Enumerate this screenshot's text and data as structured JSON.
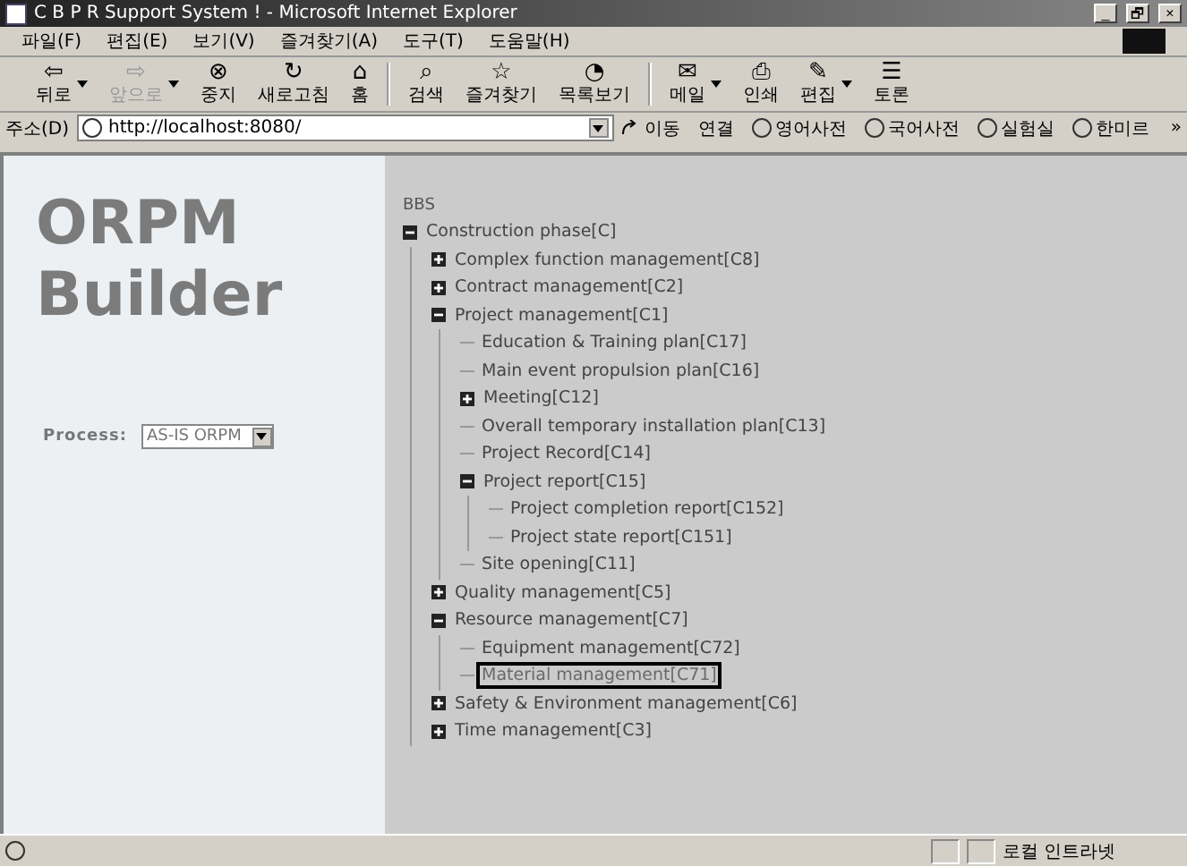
{
  "window": {
    "title": "C B P R Support System ! - Microsoft Internet Explorer",
    "controls": [
      "_",
      "🗗",
      "×"
    ]
  },
  "menu": [
    "파일(F)",
    "편집(E)",
    "보기(V)",
    "즐겨찾기(A)",
    "도구(T)",
    "도움말(H)"
  ],
  "toolbar": [
    {
      "buttons": [
        {
          "label": "뒤로",
          "glyph": "⇦",
          "dropdown": true,
          "disabled": false
        },
        {
          "label": "앞으로",
          "glyph": "⇨",
          "dropdown": true,
          "disabled": true
        },
        {
          "label": "중지",
          "glyph": "⊗",
          "dropdown": false,
          "disabled": false
        },
        {
          "label": "새로고침",
          "glyph": "↻",
          "dropdown": false,
          "disabled": false
        },
        {
          "label": "홈",
          "glyph": "⌂",
          "dropdown": false,
          "disabled": false
        }
      ]
    },
    {
      "buttons": [
        {
          "label": "검색",
          "glyph": "⌕",
          "dropdown": false,
          "disabled": false
        },
        {
          "label": "즐겨찾기",
          "glyph": "☆",
          "dropdown": false,
          "disabled": false
        },
        {
          "label": "목록보기",
          "glyph": "◔",
          "dropdown": false,
          "disabled": false
        }
      ]
    },
    {
      "buttons": [
        {
          "label": "메일",
          "glyph": "✉",
          "dropdown": true,
          "disabled": false
        },
        {
          "label": "인쇄",
          "glyph": "⎙",
          "dropdown": false,
          "disabled": false
        },
        {
          "label": "편집",
          "glyph": "✎",
          "dropdown": true,
          "disabled": false
        },
        {
          "label": "토론",
          "glyph": "☰",
          "dropdown": false,
          "disabled": false
        }
      ]
    }
  ],
  "address": {
    "label": "주소(D)",
    "value": "http://localhost:8080/",
    "go": "이동",
    "links_label": "연결",
    "links": [
      "영어사전",
      "국어사전",
      "실험실",
      "한미르"
    ],
    "more": "»"
  },
  "sidebar": {
    "title_lines": [
      "ORPM",
      "Builder"
    ],
    "process_label": "Process:",
    "process_value": "AS-IS ORPM"
  },
  "tree": {
    "root": "BBS",
    "items": [
      {
        "label": "Construction phase[C]",
        "kind": "folder",
        "expanded": true,
        "selected": false,
        "children": [
          {
            "label": "Complex function management[C8]",
            "kind": "folder",
            "expanded": false,
            "selected": false
          },
          {
            "label": "Contract management[C2]",
            "kind": "folder",
            "expanded": false,
            "selected": false
          },
          {
            "label": "Project management[C1]",
            "kind": "folder",
            "expanded": true,
            "selected": false,
            "children": [
              {
                "label": "Education & Training plan[C17]",
                "kind": "leaf",
                "selected": false
              },
              {
                "label": "Main event propulsion plan[C16]",
                "kind": "leaf",
                "selected": false
              },
              {
                "label": "Meeting[C12]",
                "kind": "folder",
                "expanded": false,
                "selected": false
              },
              {
                "label": "Overall temporary installation plan[C13]",
                "kind": "leaf",
                "selected": false
              },
              {
                "label": "Project Record[C14]",
                "kind": "leaf",
                "selected": false
              },
              {
                "label": "Project report[C15]",
                "kind": "folder",
                "expanded": true,
                "selected": false,
                "children": [
                  {
                    "label": "Project completion report[C152]",
                    "kind": "leaf",
                    "selected": false
                  },
                  {
                    "label": "Project state report[C151]",
                    "kind": "leaf",
                    "selected": false
                  }
                ]
              },
              {
                "label": "Site opening[C11]",
                "kind": "leaf",
                "selected": false
              }
            ]
          },
          {
            "label": "Quality management[C5]",
            "kind": "folder",
            "expanded": false,
            "selected": false
          },
          {
            "label": "Resource management[C7]",
            "kind": "folder",
            "expanded": true,
            "selected": false,
            "children": [
              {
                "label": "Equipment management[C72]",
                "kind": "leaf",
                "selected": false
              },
              {
                "label": "Material management[C71]",
                "kind": "leaf",
                "selected": true
              }
            ]
          },
          {
            "label": "Safety & Environment management[C6]",
            "kind": "folder",
            "expanded": false,
            "selected": false
          },
          {
            "label": "Time management[C3]",
            "kind": "folder",
            "expanded": false,
            "selected": false
          }
        ]
      }
    ]
  },
  "status_bar": {
    "zone": "로컬 인트라넷"
  }
}
